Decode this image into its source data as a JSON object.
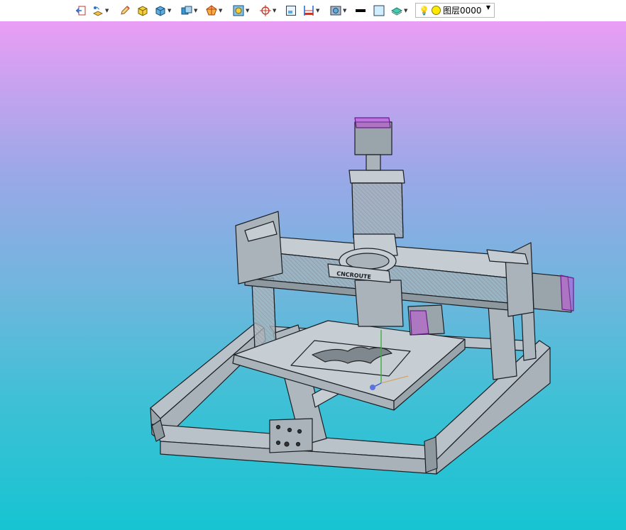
{
  "toolbar": {
    "buttons": [
      {
        "icon": "exit-sketch-icon",
        "dropdown": false
      },
      {
        "icon": "sketch-plane-icon",
        "dropdown": true
      },
      {
        "icon": "pencil-icon",
        "dropdown": false
      },
      {
        "icon": "cube-yellow-icon",
        "dropdown": false
      },
      {
        "icon": "cube-blue-icon",
        "dropdown": true
      },
      {
        "icon": "box-view-icon",
        "dropdown": true
      },
      {
        "icon": "polygon-icon",
        "dropdown": true
      },
      {
        "icon": "face-select-icon",
        "dropdown": true
      },
      {
        "icon": "crosshair-icon",
        "dropdown": true
      },
      {
        "icon": "frame-icon",
        "dropdown": false
      },
      {
        "icon": "dimension-icon",
        "dropdown": true
      },
      {
        "icon": "display-mode-icon",
        "dropdown": true
      },
      {
        "icon": "line-color-icon",
        "dropdown": false
      },
      {
        "icon": "fill-color-icon",
        "dropdown": false
      },
      {
        "icon": "layer-stack-icon",
        "dropdown": true
      }
    ],
    "layer_label": "图层0000"
  },
  "model": {
    "brand_text": "CNCROUTE"
  },
  "colors": {
    "frame": "#b9c2c8",
    "frame_edge": "#1a1f24",
    "motor_accent": "#c04cd8"
  }
}
